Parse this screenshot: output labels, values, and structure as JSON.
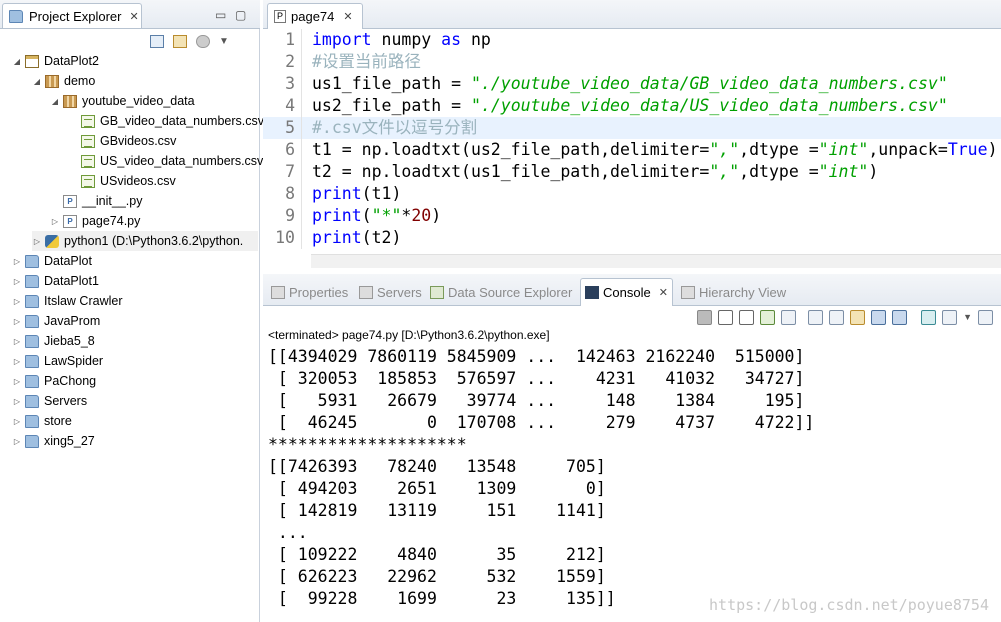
{
  "explorer": {
    "tab_label": "Project Explorer",
    "tab_close": "✕",
    "minimize": "▭",
    "maximize": "▢",
    "tree": [
      {
        "label": "DataPlot2",
        "icon": "project-icon",
        "arrow": "◢"
      },
      {
        "label": "demo",
        "icon": "package-icon",
        "arrow": "◢"
      },
      {
        "label": "youtube_video_data",
        "icon": "package-icon",
        "arrow": "◢"
      },
      {
        "label": "GB_video_data_numbers.csv",
        "icon": "csv-file-icon",
        "arrow": ""
      },
      {
        "label": "GBvideos.csv",
        "icon": "csv-file-icon",
        "arrow": ""
      },
      {
        "label": "US_video_data_numbers.csv",
        "icon": "csv-file-icon",
        "arrow": ""
      },
      {
        "label": "USvideos.csv",
        "icon": "csv-file-icon",
        "arrow": ""
      },
      {
        "label": "__init__.py",
        "icon": "python-file-icon",
        "arrow": ""
      },
      {
        "label": "page74.py",
        "icon": "python-file-icon",
        "arrow": "▷"
      },
      {
        "label": "python1  (D:\\Python3.6.2\\python.",
        "icon": "python-interpreter-icon",
        "arrow": "▷"
      },
      {
        "label": "DataPlot",
        "icon": "folder-icon",
        "arrow": "▷"
      },
      {
        "label": "DataPlot1",
        "icon": "folder-icon",
        "arrow": "▷"
      },
      {
        "label": "Itslaw Crawler",
        "icon": "folder-icon",
        "arrow": "▷"
      },
      {
        "label": "JavaProm",
        "icon": "folder-icon",
        "arrow": "▷"
      },
      {
        "label": "Jieba5_8",
        "icon": "folder-icon",
        "arrow": "▷"
      },
      {
        "label": "LawSpider",
        "icon": "folder-icon",
        "arrow": "▷"
      },
      {
        "label": "PaChong",
        "icon": "folder-icon",
        "arrow": "▷"
      },
      {
        "label": "Servers",
        "icon": "folder-icon",
        "arrow": "▷"
      },
      {
        "label": "store",
        "icon": "folder-icon",
        "arrow": "▷"
      },
      {
        "label": "xing5_27",
        "icon": "folder-icon",
        "arrow": "▷"
      }
    ]
  },
  "editor": {
    "tab_label": "page74",
    "tab_close": "✕",
    "line_numbers": [
      "1",
      "2",
      "3",
      "4",
      "5",
      "6",
      "7",
      "8",
      "9",
      "10"
    ]
  },
  "console": {
    "tabs": [
      "Properties",
      "Servers",
      "Data Source Explorer",
      "Console",
      "Hierarchy View"
    ],
    "tab_close": "✕",
    "terminated": "<terminated> page74.py [D:\\Python3.6.2\\python.exe]",
    "output": [
      "[[4394029 7860119 5845909 ...  142463 2162240  515000]",
      " [ 320053  185853  576597 ...    4231   41032   34727]",
      " [   5931   26679   39774 ...     148    1384     195]",
      " [  46245       0  170708 ...     279    4737    4722]]",
      "********************",
      "[[7426393   78240   13548     705]",
      " [ 494203    2651    1309       0]",
      " [ 142819   13119     151    1141]",
      " ...",
      " [ 109222    4840      35     212]",
      " [ 626223   22962     532    1559]",
      " [  99228    1699      23     135]]"
    ]
  },
  "watermark": "https://blog.csdn.net/poyue8754"
}
